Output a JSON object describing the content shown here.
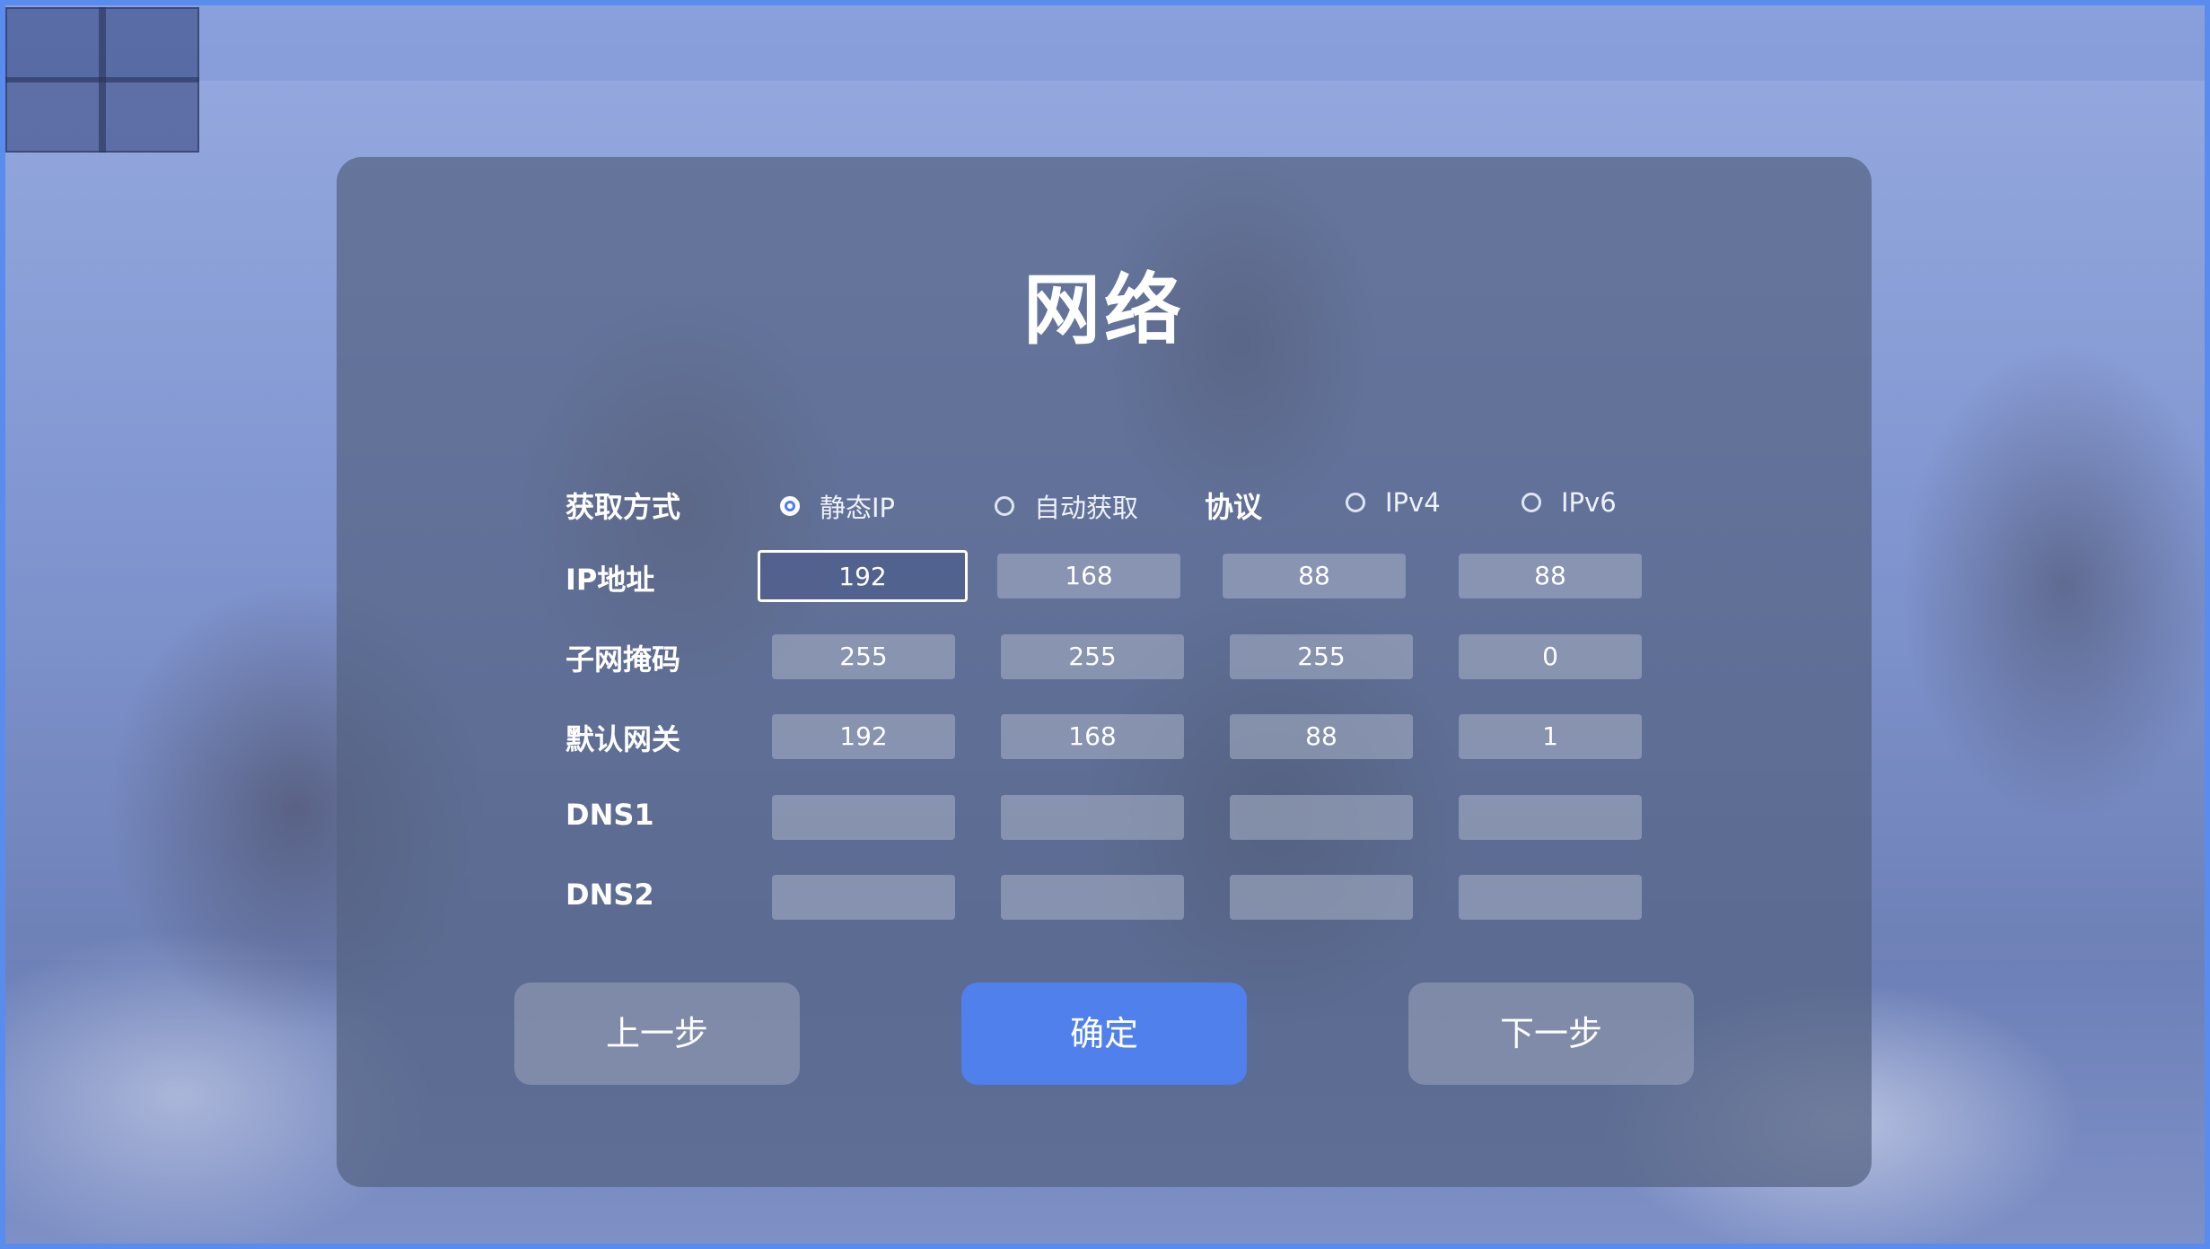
{
  "dialog": {
    "title": "网络"
  },
  "acquire": {
    "label": "获取方式",
    "options": [
      {
        "label": "静态IP",
        "checked": true
      },
      {
        "label": "自动获取",
        "checked": false
      }
    ]
  },
  "protocol": {
    "label": "协议",
    "options": [
      {
        "label": "IPv4",
        "checked": false
      },
      {
        "label": "IPv6",
        "checked": false
      }
    ]
  },
  "rows": {
    "ip": {
      "label": "IP地址",
      "values": [
        "192",
        "168",
        "88",
        "88"
      ]
    },
    "mask": {
      "label": "子网掩码",
      "values": [
        "255",
        "255",
        "255",
        "0"
      ]
    },
    "gateway": {
      "label": "默认网关",
      "values": [
        "192",
        "168",
        "88",
        "1"
      ]
    },
    "dns1": {
      "label": "DNS1",
      "values": [
        "",
        "",
        "",
        ""
      ]
    },
    "dns2": {
      "label": "DNS2",
      "values": [
        "",
        "",
        "",
        ""
      ]
    }
  },
  "buttons": {
    "prev": "上一步",
    "confirm": "确定",
    "next": "下一步"
  },
  "colors": {
    "accent": "#4f80ec",
    "frame": "#5a8cf0"
  }
}
